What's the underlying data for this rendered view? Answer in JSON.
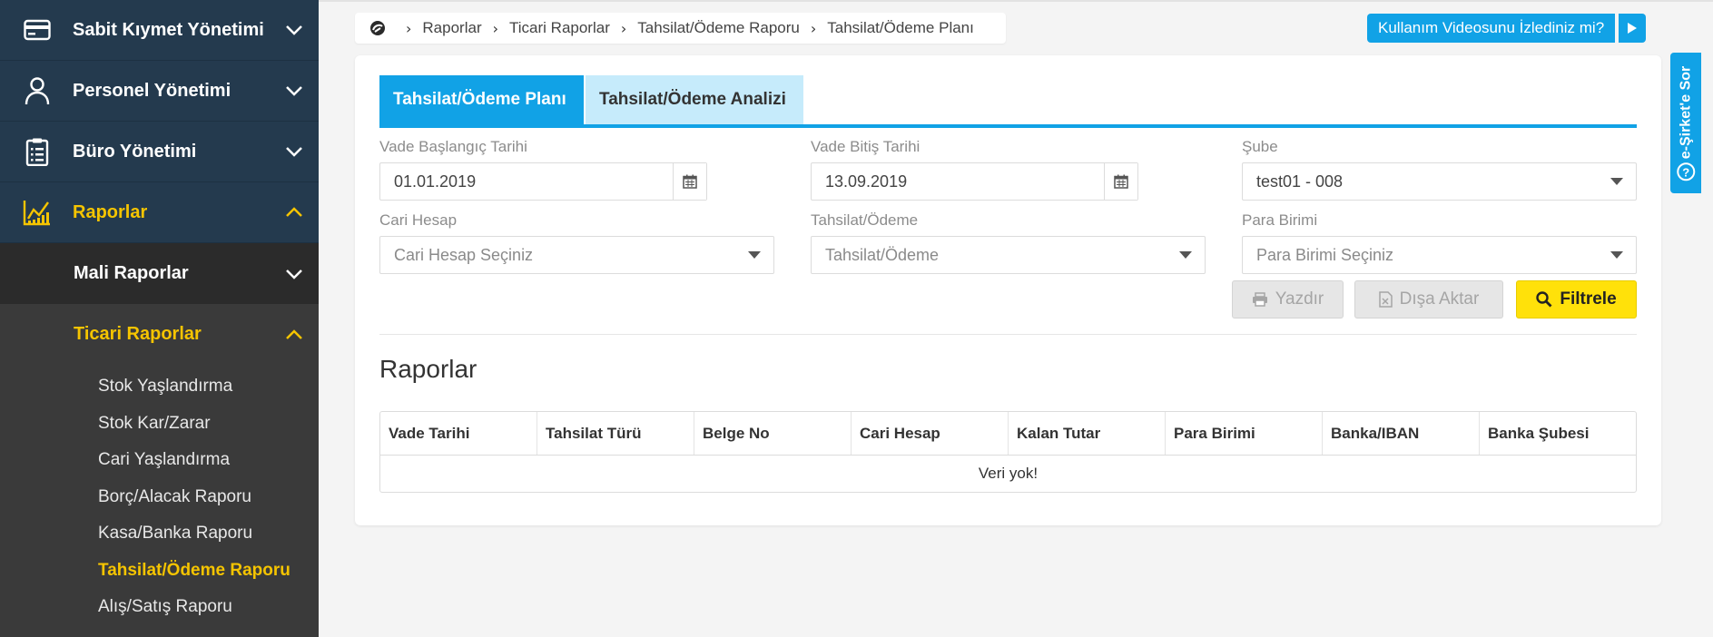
{
  "sidebar": {
    "main_items": [
      {
        "label": "Sabit Kıymet Yönetimi",
        "icon": "credit-card-icon"
      },
      {
        "label": "Personel Yönetimi",
        "icon": "person-icon"
      },
      {
        "label": "Büro Yönetimi",
        "icon": "clipboard-icon"
      },
      {
        "label": "Raporlar",
        "icon": "chart-icon"
      }
    ],
    "sub_items": [
      {
        "label": "Mali Raporlar"
      },
      {
        "label": "Ticari Raporlar"
      }
    ],
    "leaves": [
      "Stok Yaşlandırma",
      "Stok Kar/Zarar",
      "Cari Yaşlandırma",
      "Borç/Alacak Raporu",
      "Kasa/Banka Raporu",
      "Tahsilat/Ödeme Raporu",
      "Alış/Satış Raporu"
    ],
    "active_color": "#f5c400",
    "background": "#243a4e"
  },
  "breadcrumb": {
    "home_icon": "home-icon",
    "items": [
      "Raporlar",
      "Ticari Raporlar",
      "Tahsilat/Ödeme Raporu",
      "Tahsilat/Ödeme Planı"
    ]
  },
  "video_button": {
    "label": "Kullanım Videosunu İzlediniz mi?",
    "icon": "play-icon"
  },
  "side_tab": {
    "label": "e-Şirket'e Sor",
    "icon": "question-icon"
  },
  "tabs": [
    {
      "label": "Tahsilat/Ödeme Planı",
      "active": true
    },
    {
      "label": "Tahsilat/Ödeme Analizi",
      "active": false
    }
  ],
  "filters": {
    "vade_baslangic": {
      "label": "Vade Başlangıç Tarihi",
      "value": "01.01.2019"
    },
    "vade_bitis": {
      "label": "Vade Bitiş Tarihi",
      "value": "13.09.2019"
    },
    "sube": {
      "label": "Şube",
      "value": "test01 - 008"
    },
    "cari_hesap": {
      "label": "Cari Hesap",
      "placeholder": "Cari Hesap Seçiniz"
    },
    "tahsilat_odeme": {
      "label": "Tahsilat/Ödeme",
      "placeholder": "Tahsilat/Ödeme"
    },
    "para_birimi": {
      "label": "Para Birimi",
      "placeholder": "Para Birimi Seçiniz"
    }
  },
  "buttons": {
    "print": "Yazdır",
    "export": "Dışa Aktar",
    "filter": "Filtrele"
  },
  "reports": {
    "title": "Raporlar",
    "columns": [
      "Vade Tarihi",
      "Tahsilat Türü",
      "Belge No",
      "Cari Hesap",
      "Kalan Tutar",
      "Para Birimi",
      "Banka/IBAN",
      "Banka Şubesi"
    ],
    "empty_text": "Veri yok!"
  },
  "colors": {
    "accent": "#11a2e6",
    "primary_button": "#ffe10a"
  }
}
